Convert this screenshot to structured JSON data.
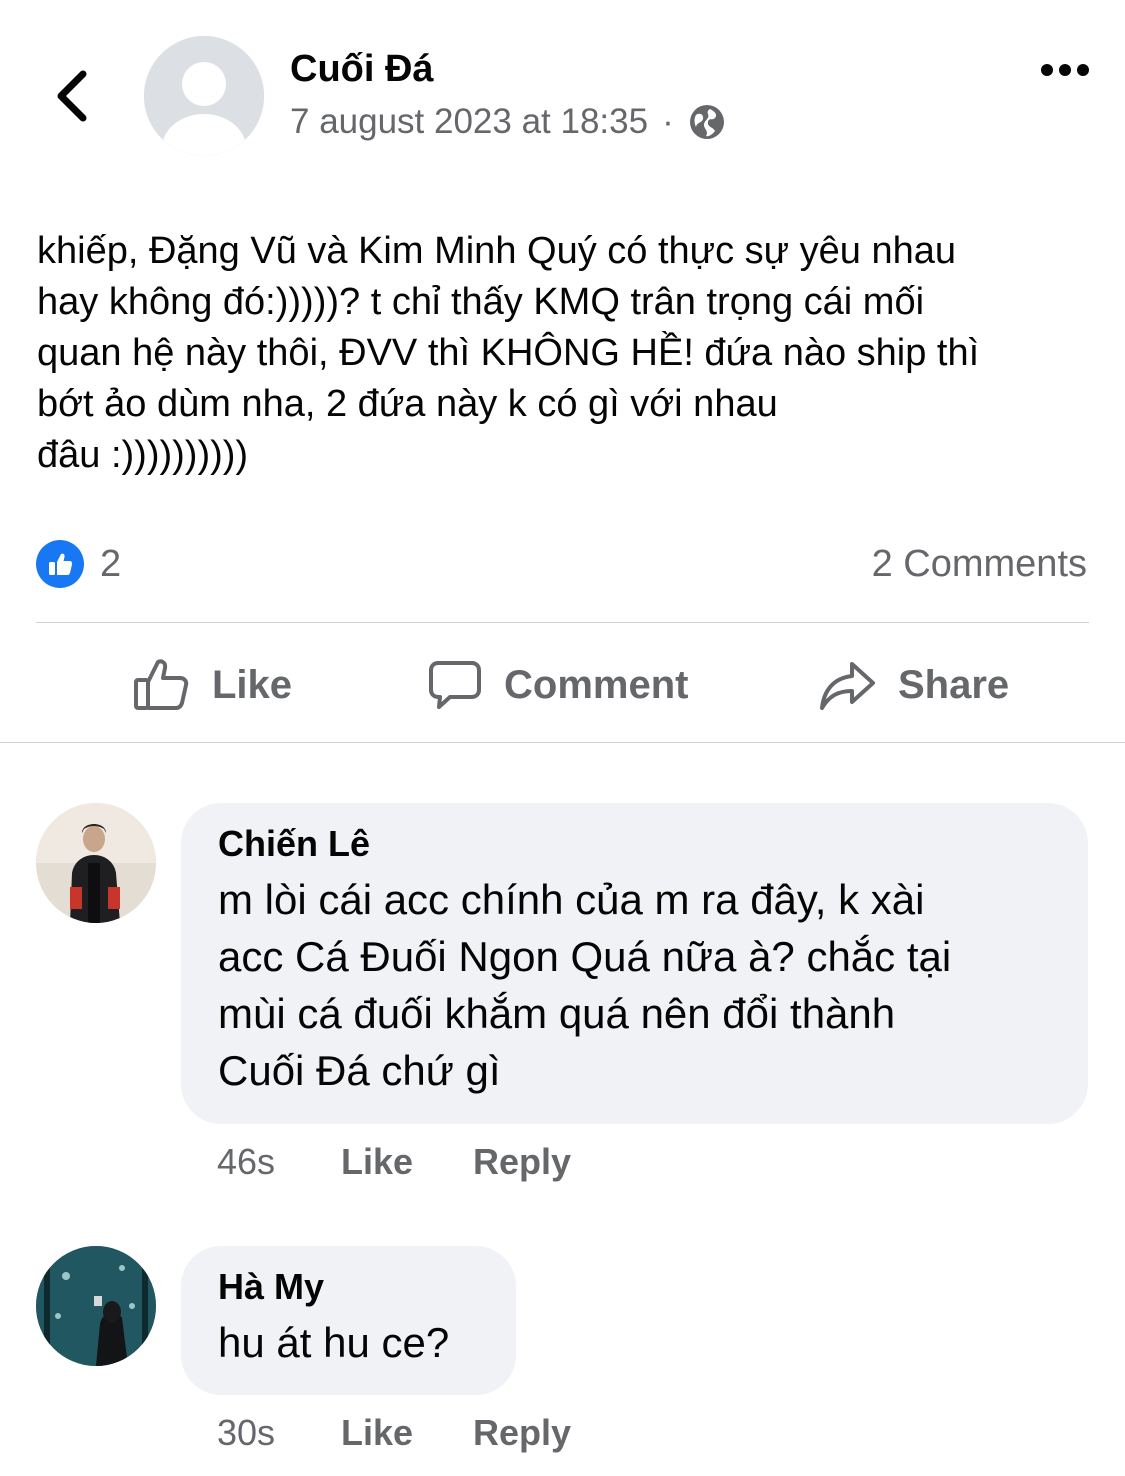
{
  "header": {
    "author": "Cuối Đá",
    "timestamp": "7 august 2023 at 18:35",
    "separator": "·",
    "privacy_icon": "globe-icon",
    "back_icon": "chevron-left-icon",
    "more_icon": "more-dots-icon"
  },
  "post": {
    "text": "khiếp, Đặng Vũ và Kim Minh Quý có thực sự yêu nhau\nhay không đó:)))))? t chỉ thấy KMQ trân trọng cái mối\nquan hệ này thôi, ĐVV thì KHÔNG HỀ! đứa nào ship thì\nbớt ảo dùm nha, 2 đứa này k có gì với nhau\nđâu :))))))))))"
  },
  "stats": {
    "like_count": "2",
    "comments_label": "2 Comments"
  },
  "actions": {
    "like": "Like",
    "comment": "Comment",
    "share": "Share"
  },
  "comments": [
    {
      "name": "Chiến Lê",
      "text": "m lòi cái acc chính của m ra đây, k xài\nacc Cá Đuối Ngon Quá nữa à? chắc tại\nmùi cá đuối khắm quá nên đổi thành\nCuối Đá chứ gì",
      "time": "46s",
      "like": "Like",
      "reply": "Reply"
    },
    {
      "name": "Hà My",
      "text": "hu át hu ce?",
      "time": "30s",
      "like": "Like",
      "reply": "Reply"
    }
  ],
  "colors": {
    "accent": "#1877f2",
    "secondary_text": "#65676b",
    "bubble": "#f0f2f5",
    "divider": "#ced0d4"
  }
}
